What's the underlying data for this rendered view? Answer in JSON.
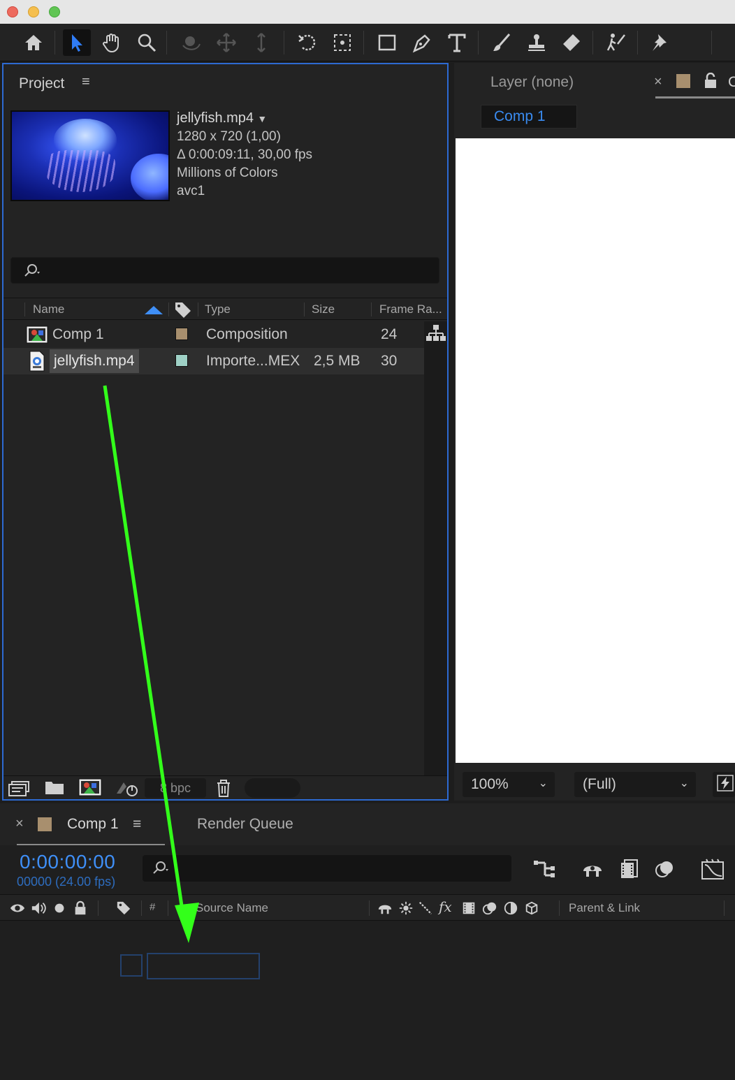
{
  "colors": {
    "accent": "#3f8ff7",
    "panel_focus": "#2d6ad2",
    "annotation_arrow": "#33ff1a",
    "comp_label": "#a88f6e",
    "footage_label": "#9fd1c6"
  },
  "toolbar": {
    "tools": [
      "home-icon",
      "selection-tool-icon",
      "hand-tool-icon",
      "zoom-tool-icon",
      "orbit-camera-icon",
      "pan-camera-icon",
      "dolly-camera-icon",
      "rotation-tool-icon",
      "pan-behind-icon",
      "rectangle-tool-icon",
      "pen-tool-icon",
      "type-tool-icon",
      "brush-tool-icon",
      "clone-stamp-icon",
      "eraser-tool-icon",
      "roto-brush-icon",
      "puppet-pin-icon"
    ]
  },
  "project": {
    "title": "Project",
    "file": {
      "name": "jellyfish.mp4",
      "dimensions": "1280 x 720 (1,00)",
      "duration": "Δ 0:00:09:11, 30,00 fps",
      "colors": "Millions of Colors",
      "codec": "avc1"
    },
    "columns": {
      "name": "Name",
      "type": "Type",
      "size": "Size",
      "frame_rate": "Frame Ra..."
    },
    "items": [
      {
        "name": "Comp 1",
        "type": "Composition",
        "size": "",
        "frame_rate": "24",
        "label_color": "#a88f6e"
      },
      {
        "name": "jellyfish.mp4",
        "type": "Importe...MEX",
        "size": "2,5 MB",
        "frame_rate": "30",
        "label_color": "#9fd1c6"
      }
    ],
    "bit_depth": "8 bpc"
  },
  "viewer": {
    "layer_tab": "Layer (none)",
    "comp_button": "Comp 1",
    "zoom": "100%",
    "resolution": "(Full)"
  },
  "timeline": {
    "tab_comp": "Comp 1",
    "tab_render": "Render Queue",
    "timecode": "0:00:00:00",
    "frame_info": "00000 (24.00 fps)",
    "columns": {
      "number": "#",
      "source_name": "Source Name",
      "parent": "Parent & Link"
    }
  }
}
